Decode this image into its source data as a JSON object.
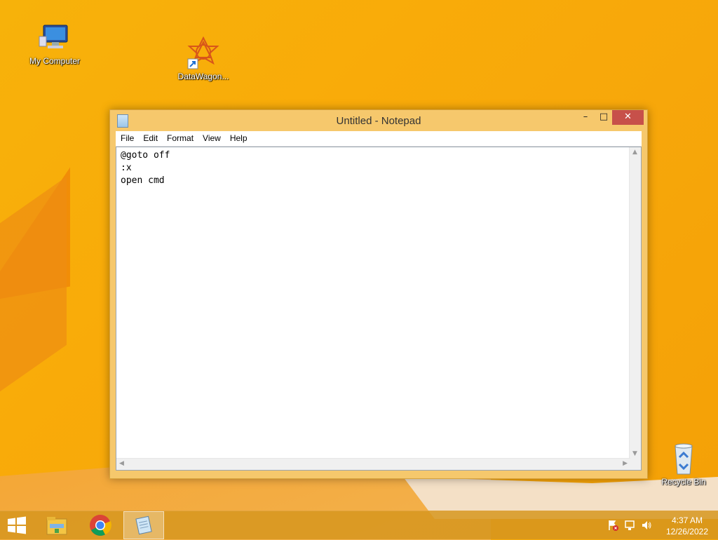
{
  "desktop": {
    "icons": [
      {
        "label": "My Computer"
      },
      {
        "label": "DataWagon..."
      },
      {
        "label": "Recycle Bin"
      }
    ]
  },
  "notepad": {
    "title": "Untitled - Notepad",
    "menu": [
      "File",
      "Edit",
      "Format",
      "View",
      "Help"
    ],
    "content": "@goto off\n:x\nopen cmd",
    "controls": {
      "minimize": "–",
      "maximize": "□",
      "close": "✕"
    }
  },
  "taskbar": {
    "time": "4:37 AM",
    "date": "12/26/2022",
    "apps": [
      "start-icon",
      "file-explorer-icon",
      "chrome-icon",
      "notepad-icon"
    ],
    "tray_icons": [
      "action-center-flag-icon",
      "network-icon",
      "volume-icon"
    ]
  },
  "colors": {
    "wallpaper": "#f7b20a",
    "close_button": "#c7504a",
    "window_frame": "#f6c86c"
  }
}
